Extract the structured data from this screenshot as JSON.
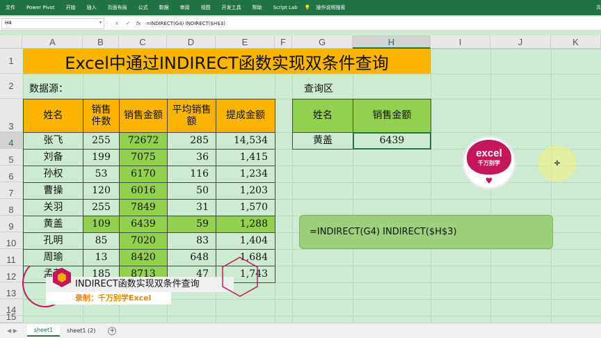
{
  "ribbon": {
    "tabs": [
      "文件",
      "Power Pivot",
      "开始",
      "插入",
      "页面布局",
      "公式",
      "数据",
      "审阅",
      "视图",
      "开发工具",
      "帮助",
      "Script Lab"
    ],
    "tell_me": "操作说明搜索",
    "share": "共"
  },
  "formula_bar": {
    "name_box": "H4",
    "cancel": "×",
    "enter": "✓",
    "fx": "fx",
    "formula": "=INDIRECT(G4) INDIRECT($H$3)"
  },
  "columns": [
    "A",
    "B",
    "C",
    "D",
    "E",
    "F",
    "G",
    "H",
    "I",
    "J",
    "K"
  ],
  "selected_column": "H",
  "rows": [
    "1",
    "2",
    "3",
    "4",
    "5",
    "6",
    "7",
    "8",
    "9",
    "10",
    "11",
    "12",
    "13",
    "14",
    "15"
  ],
  "selected_row": "4",
  "title": "Excel中通过INDIRECT函数实现双条件查询",
  "source_label": "数据源：",
  "query_label": "查询区",
  "table": {
    "headers": [
      "姓名",
      "销售件数",
      "销售金额",
      "平均销售额",
      "提成金额"
    ],
    "rows": [
      [
        "张飞",
        "255",
        "72672",
        "285",
        "14,534"
      ],
      [
        "刘备",
        "199",
        "7075",
        "36",
        "1,415"
      ],
      [
        "孙权",
        "53",
        "6170",
        "116",
        "1,234"
      ],
      [
        "曹操",
        "120",
        "6016",
        "50",
        "1,203"
      ],
      [
        "关羽",
        "255",
        "7849",
        "31",
        "1,570"
      ],
      [
        "黄盖",
        "109",
        "6439",
        "59",
        "1,288"
      ],
      [
        "孔明",
        "85",
        "7020",
        "83",
        "1,404"
      ],
      [
        "周瑜",
        "13",
        "8420",
        "648",
        "1,684"
      ],
      [
        "孟获",
        "185",
        "8713",
        "47",
        "1,743"
      ]
    ]
  },
  "query": {
    "headers": [
      "姓名",
      "销售金额"
    ],
    "name": "黄盖",
    "value": "6439"
  },
  "formula_display": "=INDIRECT(G4) INDIRECT($H$3)",
  "logo": {
    "line1": "excel",
    "line2": "千万别学"
  },
  "banner": {
    "title": "INDIRECT函数实现双条件查询",
    "subtitle": "录制：千万别学Excel"
  },
  "sheets": [
    "sheet1",
    "sheet1 (2)"
  ],
  "active_sheet": "sheet1",
  "colors": {
    "ribbon": "#217346",
    "title_bg": "#fbb500",
    "highlight_green": "#92d050",
    "grid_bg": "#ccebd1",
    "accent_pink": "#c2185b"
  }
}
